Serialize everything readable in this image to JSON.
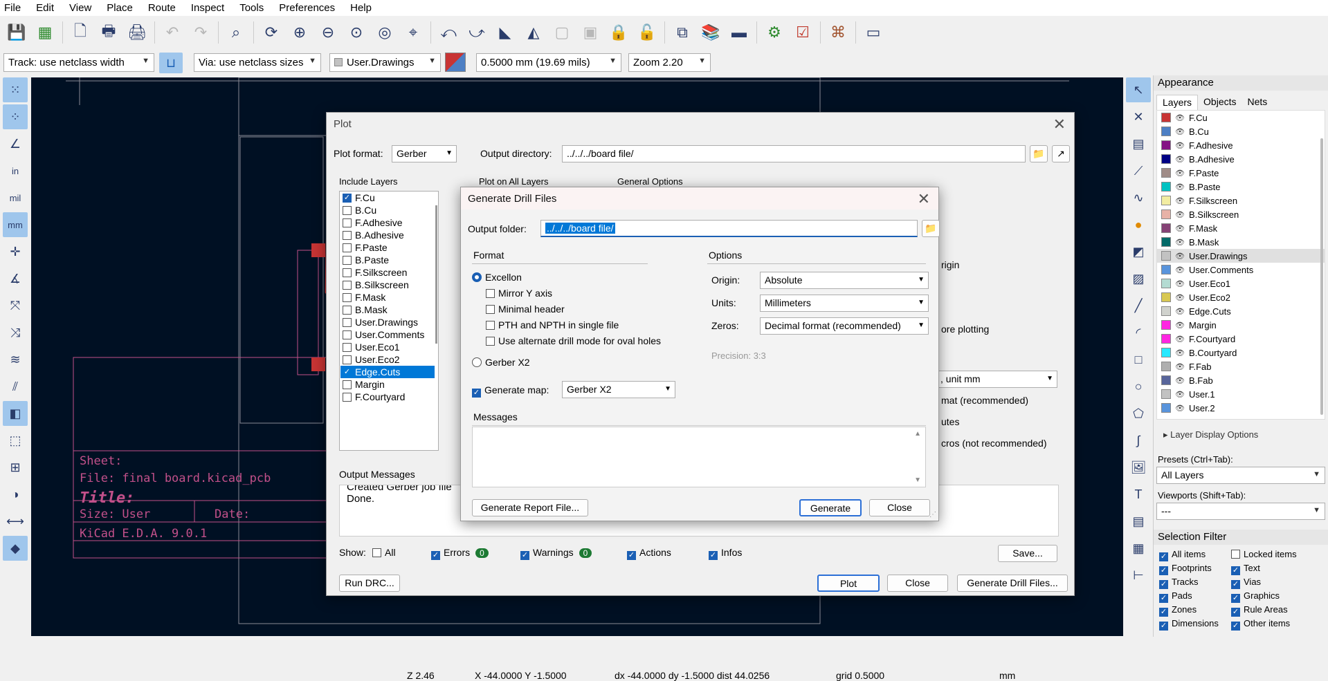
{
  "menu": [
    "File",
    "Edit",
    "View",
    "Place",
    "Route",
    "Inspect",
    "Tools",
    "Preferences",
    "Help"
  ],
  "toolbar": {
    "track_width": "Track: use netclass width",
    "via_size": "Via: use netclass sizes",
    "active_layer": "User.Drawings",
    "grid": "0.5000 mm (19.69 mils)",
    "zoom": "Zoom 2.20"
  },
  "left_toolbar_labels": {
    "in": "in",
    "mil": "mil",
    "mm": "mm"
  },
  "titleblock": {
    "sheet": "Sheet:",
    "file": "File: final board.kicad_pcb",
    "title": "Title:",
    "size": "Size: User",
    "date": "Date:",
    "kicad": "KiCad E.D.A. 9.0.1"
  },
  "plot": {
    "title": "Plot",
    "plot_format_label": "Plot format:",
    "plot_format": "Gerber",
    "output_dir_label": "Output directory:",
    "output_dir": "../../../board file/",
    "include_layers_label": "Include Layers",
    "plot_on_all_label": "Plot on All Layers",
    "general_options_label": "General Options",
    "layers": [
      {
        "name": "F.Cu",
        "checked": true
      },
      {
        "name": "B.Cu",
        "checked": false
      },
      {
        "name": "F.Adhesive",
        "checked": false
      },
      {
        "name": "B.Adhesive",
        "checked": false
      },
      {
        "name": "F.Paste",
        "checked": false
      },
      {
        "name": "B.Paste",
        "checked": false
      },
      {
        "name": "F.Silkscreen",
        "checked": false
      },
      {
        "name": "B.Silkscreen",
        "checked": false
      },
      {
        "name": "F.Mask",
        "checked": false
      },
      {
        "name": "B.Mask",
        "checked": false
      },
      {
        "name": "User.Drawings",
        "checked": false
      },
      {
        "name": "User.Comments",
        "checked": false
      },
      {
        "name": "User.Eco1",
        "checked": false
      },
      {
        "name": "User.Eco2",
        "checked": false
      },
      {
        "name": "Edge.Cuts",
        "checked": true
      },
      {
        "name": "Margin",
        "checked": false
      },
      {
        "name": "F.Courtyard",
        "checked": false
      }
    ],
    "partial_right": {
      "origin": "rigin",
      "before_plotting": "ore plotting",
      "unit": ", unit mm",
      "format": "mat (recommended)",
      "attributes": "utes",
      "macros": "cros (not recommended)"
    },
    "output_messages_label": "Output Messages",
    "messages": [
      "Created Gerber job file",
      "Done."
    ],
    "show_label": "Show:",
    "show_all": "All",
    "errors": "Errors",
    "errors_count": "0",
    "warnings": "Warnings",
    "warnings_count": "0",
    "actions": "Actions",
    "infos": "Infos",
    "save": "Save...",
    "run_drc": "Run DRC...",
    "plot_btn": "Plot",
    "close": "Close",
    "generate_drill": "Generate Drill Files..."
  },
  "drill": {
    "title": "Generate Drill Files",
    "output_folder_label": "Output folder:",
    "output_folder": "../../../board file/",
    "format_label": "Format",
    "excellon": "Excellon",
    "mirror_y": "Mirror Y axis",
    "minimal_header": "Minimal header",
    "pth_npth": "PTH and NPTH in single file",
    "alt_drill": "Use alternate drill mode for oval holes",
    "gerber_x2": "Gerber X2",
    "generate_map": "Generate map:",
    "map_format": "Gerber X2",
    "options_label": "Options",
    "origin_label": "Origin:",
    "origin": "Absolute",
    "units_label": "Units:",
    "units": "Millimeters",
    "zeros_label": "Zeros:",
    "zeros": "Decimal format (recommended)",
    "precision": "Precision: 3:3",
    "messages_label": "Messages",
    "report_btn": "Generate Report File...",
    "generate_btn": "Generate",
    "close_btn": "Close"
  },
  "appearance": {
    "title": "Appearance",
    "tabs": [
      "Layers",
      "Objects",
      "Nets"
    ],
    "layers": [
      {
        "name": "F.Cu",
        "color": "#c83434"
      },
      {
        "name": "B.Cu",
        "color": "#4d7fc4"
      },
      {
        "name": "F.Adhesive",
        "color": "#841384"
      },
      {
        "name": "B.Adhesive",
        "color": "#000084"
      },
      {
        "name": "F.Paste",
        "color": "#a08c87"
      },
      {
        "name": "B.Paste",
        "color": "#00c2c2"
      },
      {
        "name": "F.Silkscreen",
        "color": "#f2eda1"
      },
      {
        "name": "B.Silkscreen",
        "color": "#e8b2a7"
      },
      {
        "name": "F.Mask",
        "color": "#854275"
      },
      {
        "name": "B.Mask",
        "color": "#026a68"
      },
      {
        "name": "User.Drawings",
        "color": "#c2c2c2"
      },
      {
        "name": "User.Comments",
        "color": "#5994dc"
      },
      {
        "name": "User.Eco1",
        "color": "#b4dbd2"
      },
      {
        "name": "User.Eco2",
        "color": "#d8c852"
      },
      {
        "name": "Edge.Cuts",
        "color": "#d0d2cd"
      },
      {
        "name": "Margin",
        "color": "#ff26e2"
      },
      {
        "name": "F.Courtyard",
        "color": "#ff26e2"
      },
      {
        "name": "B.Courtyard",
        "color": "#26e9ff"
      },
      {
        "name": "F.Fab",
        "color": "#afafaf"
      },
      {
        "name": "B.Fab",
        "color": "#58659b"
      },
      {
        "name": "User.1",
        "color": "#c2c2c2"
      },
      {
        "name": "User.2",
        "color": "#5994dc"
      }
    ],
    "layer_display_options": "Layer Display Options",
    "presets_label": "Presets (Ctrl+Tab):",
    "presets": "All Layers",
    "viewports_label": "Viewports (Shift+Tab):",
    "viewports": "---"
  },
  "selection_filter": {
    "title": "Selection Filter",
    "items": [
      "All items",
      "Locked items",
      "Footprints",
      "Text",
      "Tracks",
      "Vias",
      "Pads",
      "Graphics",
      "Zones",
      "Rule Areas",
      "Dimensions",
      "Other items"
    ],
    "checked": [
      true,
      false,
      true,
      true,
      true,
      true,
      true,
      true,
      true,
      true,
      true,
      true
    ]
  },
  "status": {
    "z": "Z 2.46",
    "xy": "X -44.0000  Y -1.5000",
    "delta": "dx -44.0000  dy -1.5000  dist 44.0256",
    "grid": "grid 0.5000",
    "units": "mm"
  },
  "colors": {
    "canvas": "#001023",
    "accent": "#1a5fb4",
    "selection": "#0078d7",
    "trace": "#c83434",
    "outline": "#c2508a",
    "badge": "#1d7a33"
  }
}
